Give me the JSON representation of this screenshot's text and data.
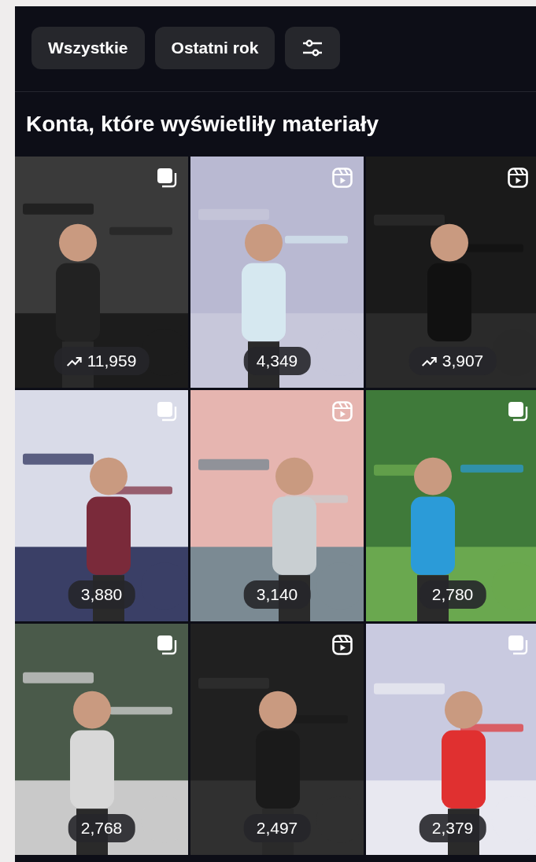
{
  "filters": [
    {
      "label": "Wszystkie",
      "kind": "chip"
    },
    {
      "label": "Ostatni rok",
      "kind": "chip"
    },
    {
      "kind": "settings"
    }
  ],
  "section": {
    "title": "Konta, które wyświetliły materiały"
  },
  "tiles": [
    {
      "kind": "carousel",
      "trending": true,
      "count": "11,959"
    },
    {
      "kind": "reel",
      "trending": false,
      "count": "4,349"
    },
    {
      "kind": "reel",
      "trending": true,
      "count": "3,907"
    },
    {
      "kind": "carousel",
      "trending": false,
      "count": "3,880"
    },
    {
      "kind": "reel",
      "trending": false,
      "count": "3,140"
    },
    {
      "kind": "carousel",
      "trending": false,
      "count": "2,780"
    },
    {
      "kind": "carousel",
      "trending": false,
      "count": "2,768"
    },
    {
      "kind": "reel",
      "trending": false,
      "count": "2,497"
    },
    {
      "kind": "carousel",
      "trending": false,
      "count": "2,379"
    }
  ]
}
